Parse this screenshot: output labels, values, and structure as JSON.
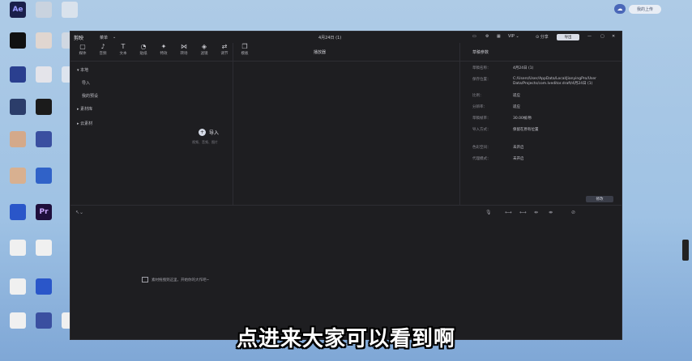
{
  "desktop": {
    "icons": [
      {
        "label": "Ae",
        "name": "after-effects-icon",
        "color": "#1a1f4a",
        "text_color": "#9a9cff"
      },
      {
        "label": "",
        "name": "desktop-icon-1",
        "color": "#c9d3df",
        "text_color": "#333"
      },
      {
        "label": "",
        "name": "desktop-icon-2",
        "color": "#d9e2ec",
        "text_color": "#333"
      },
      {
        "label": "",
        "name": "capcut-icon",
        "color": "#111111",
        "text_color": "#fff"
      },
      {
        "label": "",
        "name": "desktop-icon-3",
        "color": "#e0d6d0",
        "text_color": "#333"
      },
      {
        "label": "",
        "name": "desktop-icon-4",
        "color": "#d0d8e2",
        "text_color": "#333"
      },
      {
        "label": "",
        "name": "desktop-icon-5",
        "color": "#2a3f8f",
        "text_color": "#fff"
      },
      {
        "label": "",
        "name": "desktop-icon-6",
        "color": "#e4e4ea",
        "text_color": "#333"
      },
      {
        "label": "",
        "name": "desktop-icon-7",
        "color": "#dde4ee",
        "text_color": "#333"
      },
      {
        "label": "",
        "name": "desktop-icon-8",
        "color": "#2b3d6a",
        "text_color": "#fff"
      },
      {
        "label": "",
        "name": "desktop-icon-9",
        "color": "#1b1b1b",
        "text_color": "#fff"
      },
      {
        "label": "",
        "name": "desktop-icon-10",
        "color": "#d4a98a",
        "text_color": "#333"
      },
      {
        "label": "",
        "name": "desktop-icon-11",
        "color": "#3a4fa0",
        "text_color": "#fff"
      },
      {
        "label": "",
        "name": "desktop-icon-12",
        "color": "#d8b090",
        "text_color": "#333"
      },
      {
        "label": "",
        "name": "desktop-icon-13",
        "color": "#3062c8",
        "text_color": "#fff"
      },
      {
        "label": "",
        "name": "desktop-icon-14",
        "color": "#2a56c9",
        "text_color": "#fff"
      },
      {
        "label": "Pr",
        "name": "premiere-icon",
        "color": "#1f0f3c",
        "text_color": "#c9a8ff"
      },
      {
        "label": "",
        "name": "desktop-icon-15",
        "color": "#f0f0f0",
        "text_color": "#333"
      },
      {
        "label": "",
        "name": "desktop-icon-16",
        "color": "#f0f0f0",
        "text_color": "#333"
      },
      {
        "label": "",
        "name": "desktop-icon-17",
        "color": "#f0f0f0",
        "text_color": "#333"
      },
      {
        "label": "",
        "name": "desktop-icon-18",
        "color": "#2a56c9",
        "text_color": "#fff"
      },
      {
        "label": "",
        "name": "desktop-icon-19",
        "color": "#f0f0f0",
        "text_color": "#333"
      },
      {
        "label": "",
        "name": "desktop-icon-20",
        "color": "#3a4fa0",
        "text_color": "#fff"
      },
      {
        "label": "",
        "name": "desktop-icon-21",
        "color": "#f0f0f0",
        "text_color": "#333"
      }
    ]
  },
  "upload_widget": {
    "button": "我的上传"
  },
  "app": {
    "logo": "剪映",
    "menu": "菜单",
    "title": "4月24日 (1)",
    "export": "导出",
    "toolbar": [
      {
        "label": "媒体",
        "icon": "▢",
        "name": "toolbar-media"
      },
      {
        "label": "音频",
        "icon": "♪",
        "name": "toolbar-audio"
      },
      {
        "label": "文本",
        "icon": "T",
        "name": "toolbar-text"
      },
      {
        "label": "贴纸",
        "icon": "◔",
        "name": "toolbar-sticker"
      },
      {
        "label": "特效",
        "icon": "✦",
        "name": "toolbar-effects"
      },
      {
        "label": "转场",
        "icon": "⋈",
        "name": "toolbar-transition"
      },
      {
        "label": "滤镜",
        "icon": "◈",
        "name": "toolbar-filter"
      },
      {
        "label": "调节",
        "icon": "⇄",
        "name": "toolbar-adjust"
      },
      {
        "label": "模板",
        "icon": "❐",
        "name": "toolbar-template"
      }
    ],
    "sidebar": [
      {
        "label": "▾ 本地",
        "name": "sidebar-local"
      },
      {
        "label": "导入",
        "name": "sidebar-import"
      },
      {
        "label": "我的预设",
        "name": "sidebar-presets"
      },
      {
        "label": "▸ 素材库",
        "name": "sidebar-library"
      },
      {
        "label": "▸ 云素材",
        "name": "sidebar-cloud"
      }
    ],
    "import_label": "导入",
    "import_hint": "视频、音频、图片",
    "player_title": "播放器",
    "draft_title": "草稿参数",
    "properties": [
      {
        "label": "草稿名称：",
        "value": "4月24日 (1)"
      },
      {
        "label": "保存位置：",
        "value": "C:/Users/User/AppData/Local/JianyingPro/User Data/Projects/com.lveditor.draft/4月24日 (1)"
      },
      {
        "label": "比例：",
        "value": "适应"
      },
      {
        "label": "分辨率：",
        "value": "适应"
      },
      {
        "label": "草稿帧率：",
        "value": "30.00帧/秒"
      },
      {
        "label": "导入方式：",
        "value": "保留在原有位置"
      },
      {
        "label": "色彩空间：",
        "value": "未开启"
      },
      {
        "label": "代理模式：",
        "value": "未开启"
      }
    ],
    "edit_button": "修改",
    "timeline_hint": "素材拖拽到这里，开始你的大作吧~"
  },
  "subtitle": "点进来大家可以看到啊"
}
